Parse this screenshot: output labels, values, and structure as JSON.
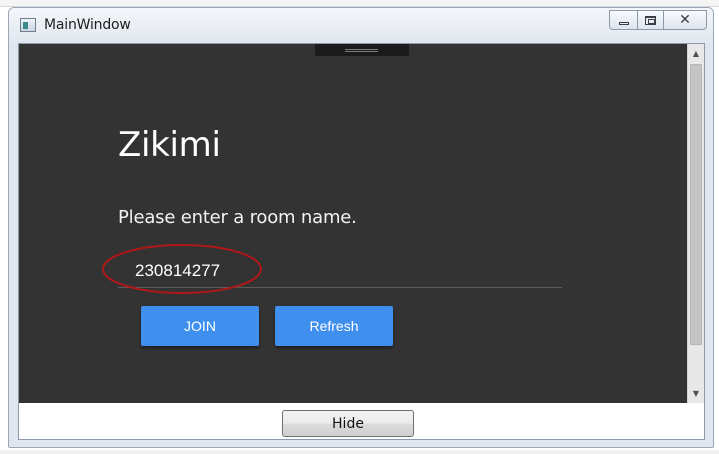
{
  "window": {
    "title": "MainWindow",
    "minimize_icon": "minimize-icon",
    "maximize_icon": "restore-icon",
    "close_icon": "close-icon"
  },
  "main": {
    "app_title": "Zikimi",
    "prompt": "Please enter a room name.",
    "room_input": {
      "value": "230814277",
      "placeholder": ""
    },
    "join_label": "JOIN",
    "refresh_label": "Refresh"
  },
  "footer": {
    "hide_label": "Hide"
  },
  "colors": {
    "panel_background": "#333333",
    "button_blue": "#3f8fef",
    "highlight_ellipse": "#b01818"
  }
}
